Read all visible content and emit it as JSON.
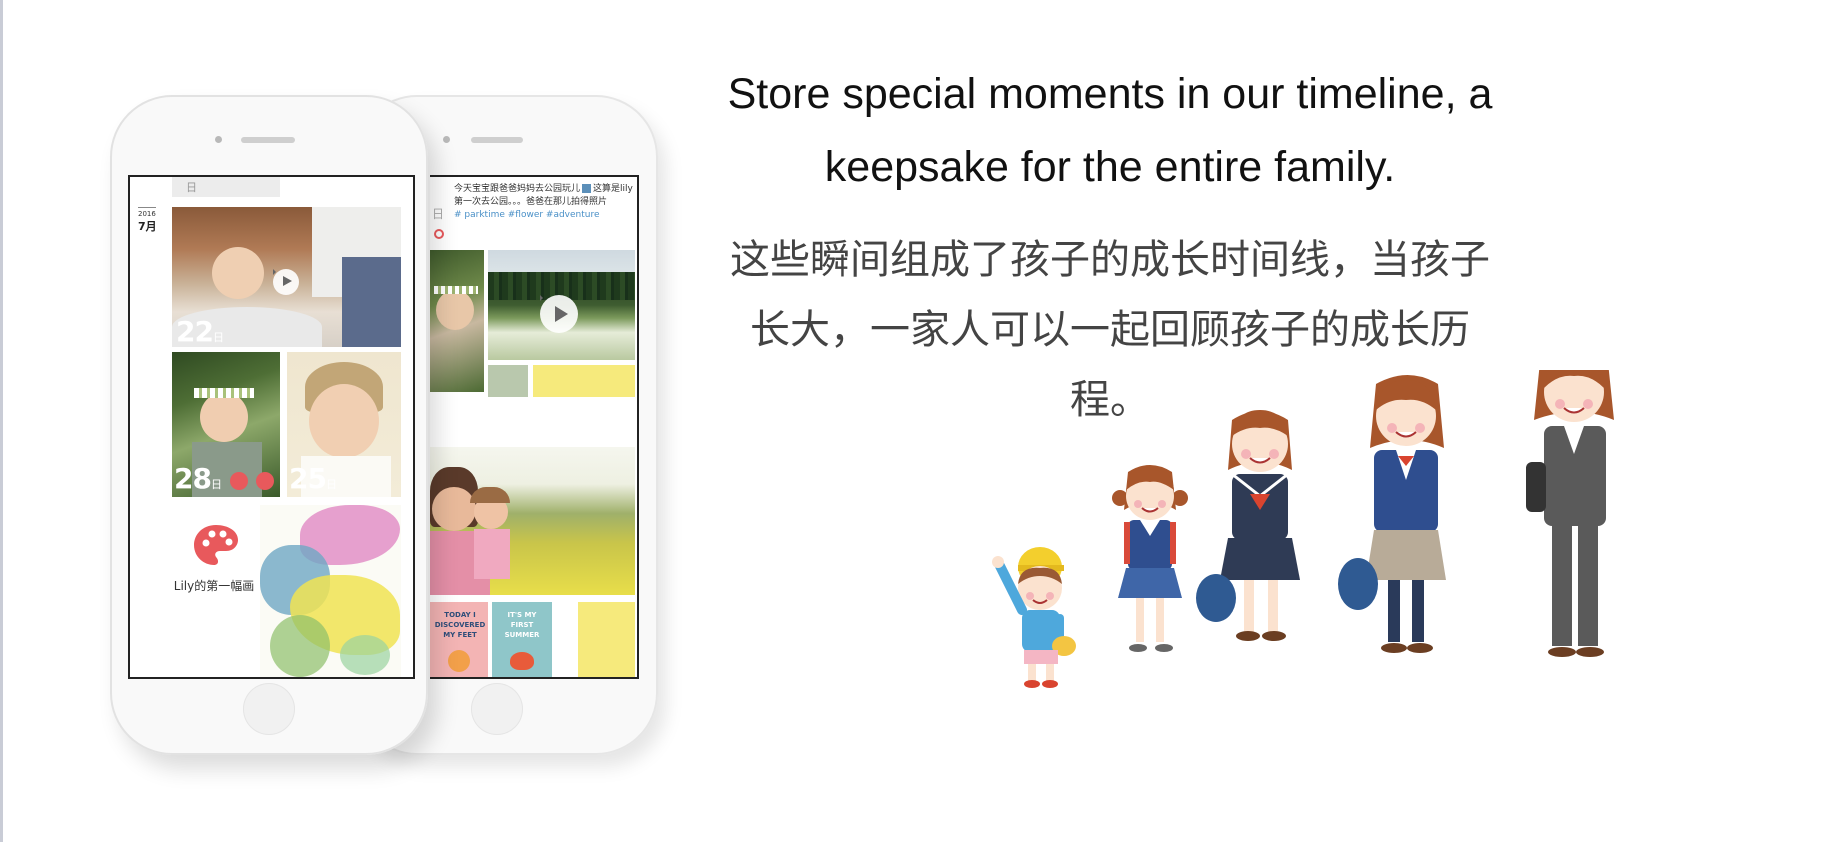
{
  "headline": {
    "en_line1": "Store special moments in our timeline, a",
    "en_line2": "keepsake for the entire family.",
    "zh_line1": "这些瞬间组成了孩子的成长时间线，当孩子",
    "zh_line2": "长大，一家人可以一起回顾孩子的成长历",
    "zh_line3": "程。"
  },
  "front_phone": {
    "year": "2016",
    "month": "7月",
    "partial_day_suffix": "日",
    "dates": [
      {
        "num": "22",
        "suffix": "日"
      },
      {
        "num": "28",
        "suffix": "日"
      },
      {
        "num": "25",
        "suffix": "日"
      }
    ],
    "drawing_label": "Lily的第一幅画"
  },
  "back_phone": {
    "post_text": "今天宝宝跟爸爸妈妈去公园玩儿",
    "post_text_2": "这算是lily",
    "post_text_3": "第一次去公园。。。爸爸在那儿拍得照片",
    "hashtags": "# parktime #flower #adventure",
    "side_label": "日",
    "card1": "TODAY I DISCOVERED MY FEET",
    "card2": "IT'S MY FIRST SUMMER"
  },
  "colors": {
    "swatch_green": "#b9c8ad",
    "swatch_yellow": "#f6ea7c",
    "palette_red": "#e8595c",
    "hashtag_blue": "#4a90c7"
  }
}
